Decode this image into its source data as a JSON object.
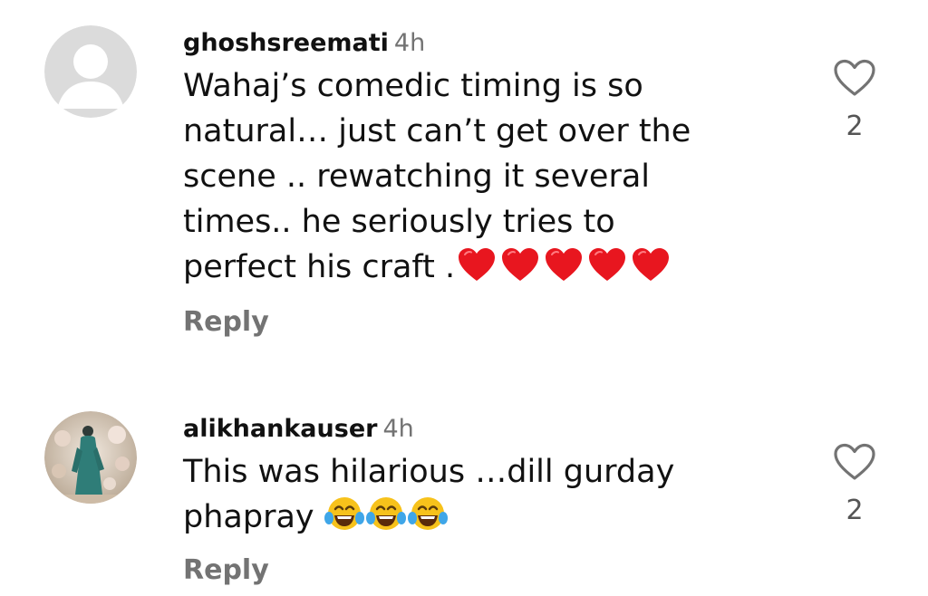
{
  "comments": [
    {
      "username": "ghoshsreemati",
      "time": "4h",
      "text_lines": [
        "Wahaj’s comedic timing is so",
        "natural… just can’t get over the",
        "scene .. rewatching it several",
        "times.. he seriously tries to",
        "perfect his craft ."
      ],
      "emoji": [
        "red-heart",
        "red-heart",
        "red-heart",
        "red-heart",
        "red-heart"
      ],
      "reply_label": "Reply",
      "like_count": "2"
    },
    {
      "username": "alikhankauser",
      "time": "4h",
      "text_lines": [
        "This was hilarious …dill gurday",
        "phapray"
      ],
      "emoji": [
        "tears-of-joy",
        "tears-of-joy",
        "tears-of-joy"
      ],
      "reply_label": "Reply",
      "like_count": "2"
    }
  ],
  "colors": {
    "secondary_text": "#737373",
    "heart_red": "#e8161f",
    "emoji_yellow": "#f7c21b"
  }
}
